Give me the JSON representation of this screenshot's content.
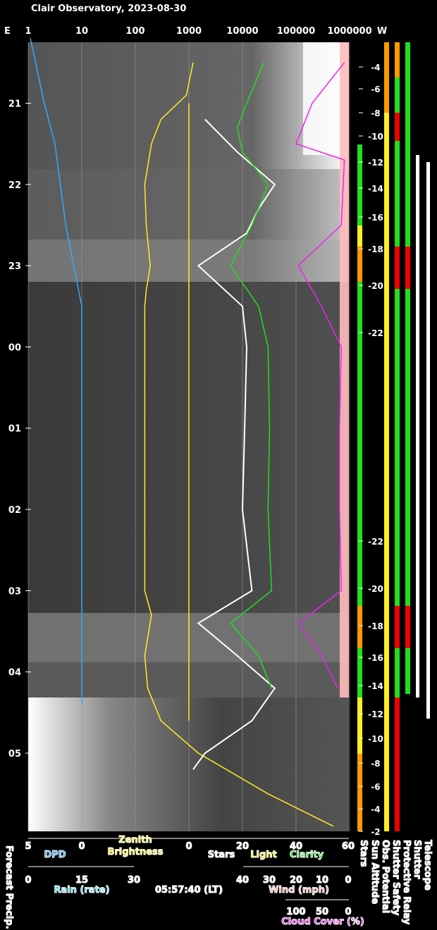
{
  "title": "Clair Observatory, 2023-08-30",
  "colors": {
    "white": "#ffffff",
    "cyan": "#33aaff",
    "yellow": "#ffee22",
    "green": "#22dd22",
    "pink": "#ffbbbb",
    "magenta": "#ee22ee",
    "orange": "#ff9900",
    "red": "#ee0000",
    "lightcyan": "#44ddff",
    "wind": "#ffaaaa"
  },
  "top_axis": {
    "left_label": "E",
    "right_label": "W",
    "ticks": [
      "1",
      "10",
      "100",
      "1000",
      "10000",
      "100000",
      "1000000"
    ]
  },
  "time_axis": {
    "labels": [
      "21",
      "22",
      "23",
      "00",
      "01",
      "02",
      "03",
      "04",
      "05"
    ]
  },
  "sun_altitude": {
    "upper_labels": [
      "-4",
      "-6",
      "-8",
      "-10",
      "-12",
      "-14",
      "-16",
      "-18",
      "-20",
      "-22"
    ],
    "lower_labels": [
      "-22",
      "-20",
      "-18",
      "-16",
      "-14",
      "-12",
      "-10",
      "-8",
      "-6",
      "-4",
      "-2"
    ]
  },
  "bottom_scales": {
    "dpd": {
      "label": "DPD",
      "ticks": [
        "5",
        "0"
      ]
    },
    "zenith": {
      "label_line1": "Zenith",
      "label_line2": "Brightness",
      "tick": "0"
    },
    "stars_light_clarity": {
      "ticks": [
        "20",
        "40",
        "60"
      ],
      "stars": "Stars",
      "light": "Light",
      "clarity": "Clarity"
    },
    "rain": {
      "label": "Rain (rate)",
      "ticks": [
        "0",
        "15",
        "30"
      ]
    },
    "time_lt": "05:57:40 (LT)",
    "wind": {
      "label": "Wind (mph)",
      "ticks": [
        "40",
        "30",
        "20",
        "10",
        "0"
      ]
    },
    "cloud": {
      "label": "Cloud Cover (%)",
      "ticks": [
        "100",
        "50",
        "0"
      ]
    },
    "forecast": "Forecast Precip."
  },
  "vertical_labels": [
    "Stars",
    "Sun Altitude",
    "Obs. Potential",
    "Shutter Safety",
    "Protective Relay",
    "Shutter",
    "Telescope"
  ],
  "chart_data": {
    "type": "line",
    "title": "Clair Observatory, 2023-08-30",
    "x_axis": "log scale 1 to 1000000",
    "time_range": [
      "20:20",
      "05:58"
    ],
    "series": [
      {
        "name": "Zenith Brightness",
        "color": "yellow",
        "points": [
          [
            20.5,
            1200
          ],
          [
            20.9,
            900
          ],
          [
            21.2,
            300
          ],
          [
            21.5,
            200
          ],
          [
            22.0,
            150
          ],
          [
            22.5,
            160
          ],
          [
            23.0,
            190
          ],
          [
            23.3,
            160
          ],
          [
            23.5,
            150
          ],
          [
            3.0,
            150
          ],
          [
            3.3,
            200
          ],
          [
            3.8,
            150
          ],
          [
            4.2,
            170
          ],
          [
            4.6,
            300
          ],
          [
            5.0,
            1500
          ],
          [
            5.5,
            30000
          ],
          [
            5.9,
            500000
          ]
        ]
      },
      {
        "name": "Stars",
        "color": "white",
        "points": [
          [
            21.2,
            2000
          ],
          [
            21.6,
            8000
          ],
          [
            22.0,
            40000
          ],
          [
            22.3,
            20000
          ],
          [
            22.6,
            12000
          ],
          [
            23.0,
            1500
          ],
          [
            23.5,
            10000
          ],
          [
            0.0,
            12000
          ],
          [
            1.0,
            11000
          ],
          [
            2.0,
            10000
          ],
          [
            3.0,
            15000
          ],
          [
            3.4,
            1500
          ],
          [
            3.8,
            8000
          ],
          [
            4.2,
            40000
          ],
          [
            4.6,
            15000
          ],
          [
            5.0,
            2000
          ],
          [
            5.2,
            1200
          ]
        ]
      },
      {
        "name": "Clarity",
        "color": "green",
        "points": [
          [
            20.5,
            25000
          ],
          [
            21.0,
            12000
          ],
          [
            21.3,
            8000
          ],
          [
            21.6,
            10000
          ],
          [
            22.0,
            30000
          ],
          [
            22.5,
            15000
          ],
          [
            23.0,
            6000
          ],
          [
            23.5,
            20000
          ],
          [
            0.0,
            30000
          ],
          [
            1.0,
            32000
          ],
          [
            2.0,
            30000
          ],
          [
            3.0,
            35000
          ],
          [
            3.4,
            6000
          ],
          [
            3.8,
            20000
          ],
          [
            4.2,
            35000
          ]
        ]
      },
      {
        "name": "Cloud Cover",
        "color": "magenta",
        "points": [
          [
            20.5,
            800000
          ],
          [
            21.0,
            200000
          ],
          [
            21.5,
            100000
          ],
          [
            21.7,
            800000
          ],
          [
            22.5,
            700000
          ],
          [
            23.0,
            110000
          ],
          [
            23.5,
            300000
          ],
          [
            0.0,
            700000
          ],
          [
            1.0,
            650000
          ],
          [
            2.0,
            650000
          ],
          [
            3.0,
            700000
          ],
          [
            3.4,
            110000
          ],
          [
            3.8,
            300000
          ],
          [
            4.2,
            600000
          ]
        ]
      },
      {
        "name": "DPD",
        "color": "cyan",
        "points": [
          [
            20.2,
            5.2
          ],
          [
            21.0,
            6.5
          ],
          [
            21.5,
            7.5
          ],
          [
            22.5,
            8.5
          ],
          [
            23.5,
            10
          ],
          [
            4.4,
            10
          ]
        ]
      }
    ],
    "status_columns": [
      "Stars",
      "Sun Altitude",
      "Obs. Potential",
      "Shutter Safety",
      "Protective Relay",
      "Shutter",
      "Telescope"
    ]
  }
}
